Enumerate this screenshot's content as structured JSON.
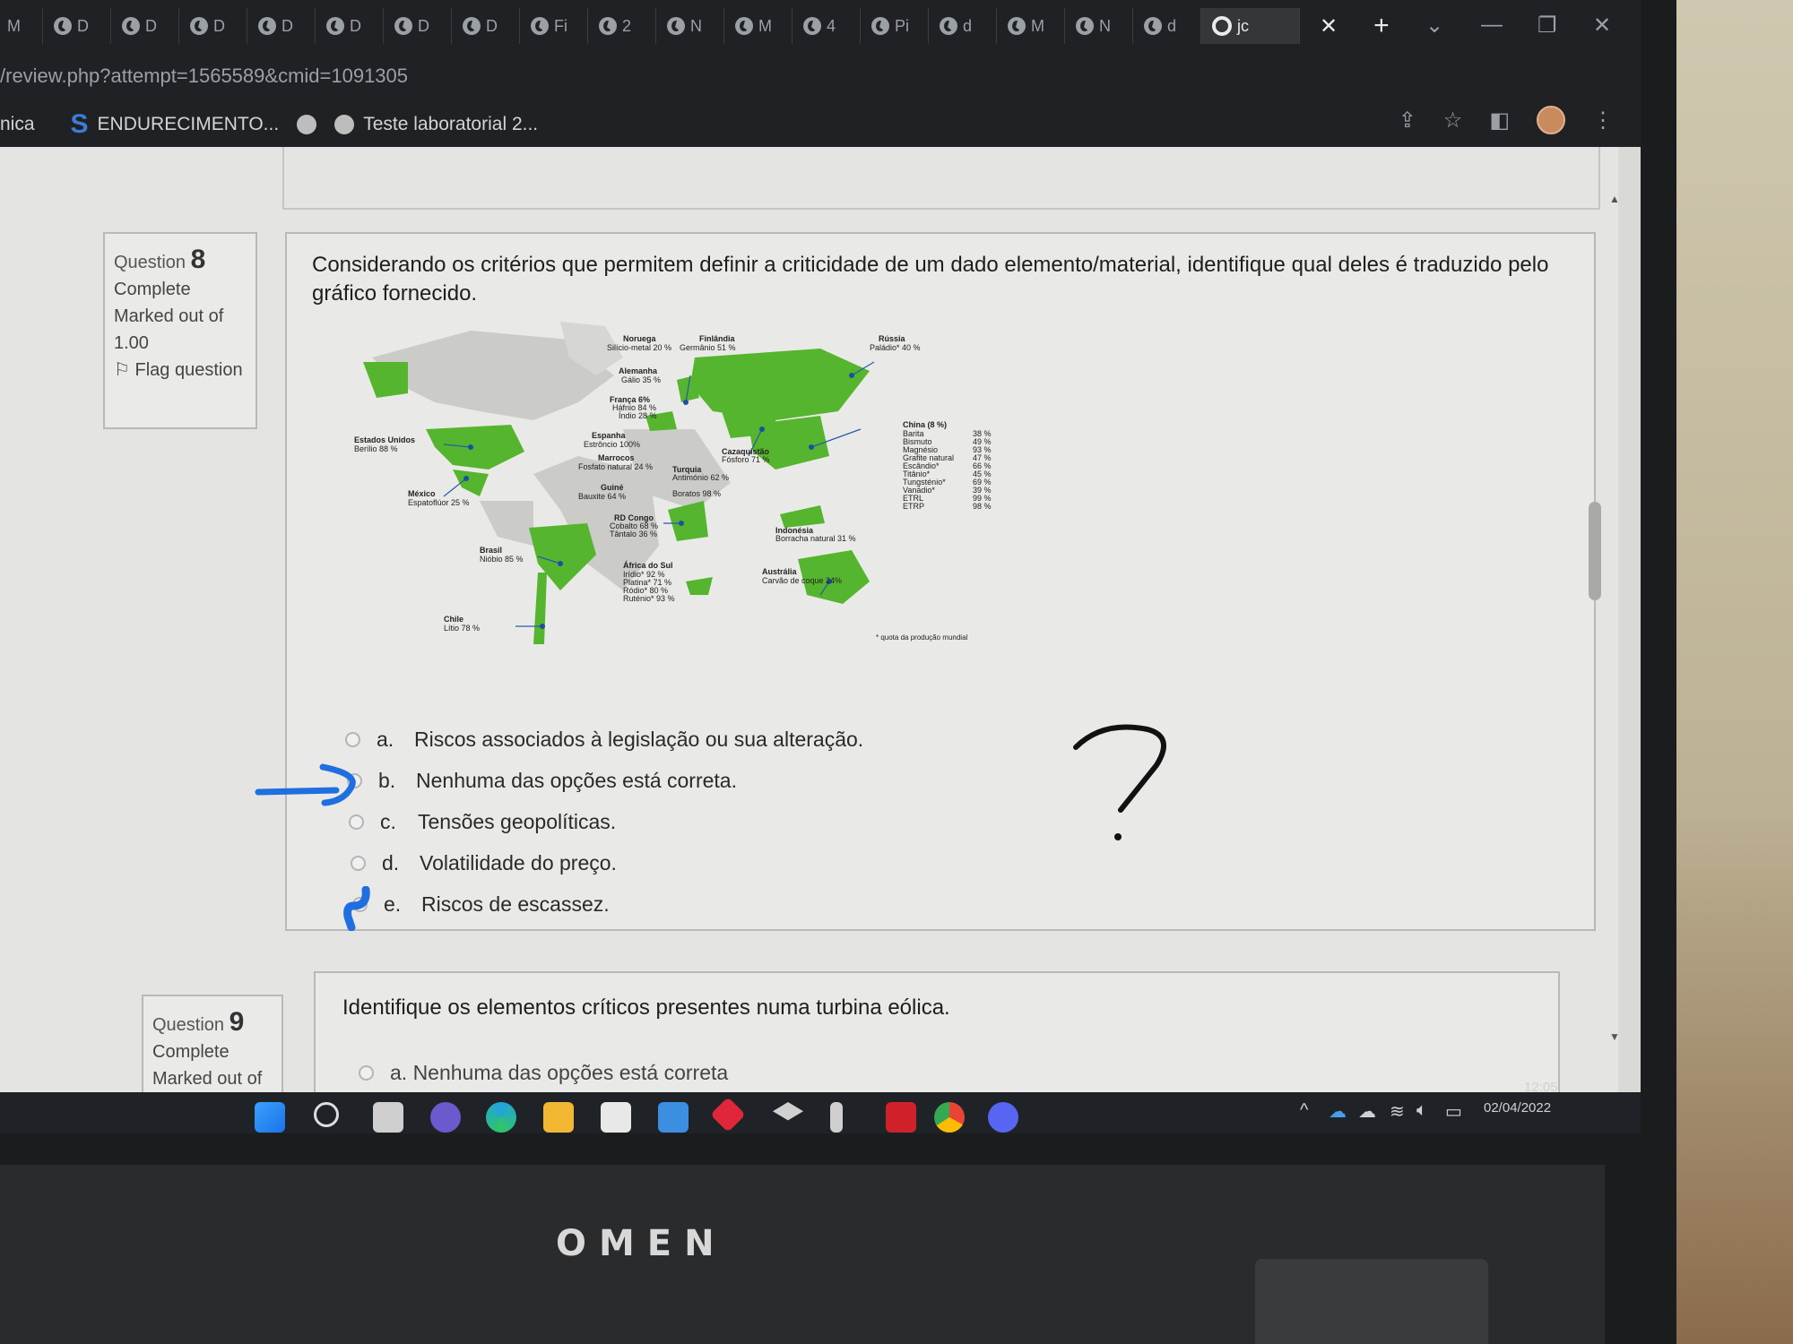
{
  "browser": {
    "tabs": [
      {
        "label": "D"
      },
      {
        "label": "D"
      },
      {
        "label": "D"
      },
      {
        "label": "D"
      },
      {
        "label": "D"
      },
      {
        "label": "D"
      },
      {
        "label": "D"
      },
      {
        "label": "Fi"
      },
      {
        "label": "2"
      },
      {
        "label": "N"
      },
      {
        "label": "M"
      },
      {
        "label": "4"
      },
      {
        "label": "Pi"
      },
      {
        "label": "d"
      },
      {
        "label": "M"
      },
      {
        "label": "N"
      },
      {
        "label": "d"
      }
    ],
    "first_tab_label": "M",
    "active_tab_label": "jc",
    "url": "/review.php?attempt=1565589&cmid=1091305",
    "bookmarks": {
      "partial": "nica",
      "item1": "ENDURECIMENTO...",
      "item2": "Teste laboratorial 2..."
    }
  },
  "question8": {
    "label": "Question",
    "number": "8",
    "status": "Complete",
    "marked": "Marked out of 1.00",
    "flag": "Flag question",
    "prompt": "Considerando os critérios que permitem definir a criticidade de um dado elemento/material, identifique qual deles é traduzido pelo gráfico fornecido.",
    "answers": [
      {
        "letter": "a.",
        "text": "Riscos associados à legislação ou sua alteração."
      },
      {
        "letter": "b.",
        "text": "Nenhuma das opções está correta."
      },
      {
        "letter": "c.",
        "text": "Tensões geopolíticas."
      },
      {
        "letter": "d.",
        "text": "Volatilidade do preço."
      },
      {
        "letter": "e.",
        "text": "Riscos de escassez."
      }
    ]
  },
  "map_labels": {
    "noruega": "Noruega",
    "noruega_v": "Silício-metal 20 %",
    "finlandia": "Finlândia",
    "finlandia_v": "Germânio 51 %",
    "russia": "Rússia",
    "russia_v": "Paládio* 40 %",
    "alemanha": "Alemanha",
    "alemanha_v": "Gálio 35 %",
    "franca": "França 6%",
    "franca_v1": "Háfnio 84 %",
    "franca_v2": "Índio 28 %",
    "eua": "Estados Unidos",
    "eua_v": "Berílio 88 %",
    "espanha": "Espanha",
    "espanha_v": "Estrôncio 100%",
    "marrocos": "Marrocos",
    "marrocos_v": "Fosfato natural 24 %",
    "cazaquistao": "Cazaquistão",
    "cazaquistao_v": "Fósforo 71 %",
    "turquia": "Turquia",
    "turquia_v1": "Antimónio 62 %",
    "turquia_v2": "Boratos 98 %",
    "mexico": "México",
    "mexico_v": "Espatoflúor 25 %",
    "guine": "Guiné",
    "guine_v": "Bauxite 64 %",
    "china": "China (8 %)",
    "china_items": [
      "Barita",
      "Bismuto",
      "Magnésio",
      "Grafite natural",
      "Escândio*",
      "Titânio*",
      "Tungsténio*",
      "Vanádio*",
      "ETRL",
      "ETRP"
    ],
    "china_values": [
      "38 %",
      "49 %",
      "93 %",
      "47 %",
      "66 %",
      "45 %",
      "69 %",
      "39 %",
      "99 %",
      "98 %"
    ],
    "rdcongo": "RD Congo",
    "rdcongo_v1": "Cobalto 68 %",
    "rdcongo_v2": "Tântalo 36 %",
    "indonesia": "Indonésia",
    "indonesia_v": "Borracha natural 31 %",
    "brasil": "Brasil",
    "brasil_v": "Nióbio 85 %",
    "chile": "Chile",
    "chile_v": "Lítio 78 %",
    "africasul": "África do Sul",
    "africasul_v": [
      "Irídio* 92 %",
      "Platina* 71 %",
      "Ródio* 80 %",
      "Ruténio* 93 %"
    ],
    "australia": "Austrália",
    "australia_v": "Carvão de coque 24%",
    "footnote": "* quota da produção mundial"
  },
  "question9": {
    "label": "Question",
    "number": "9",
    "status": "Complete",
    "marked": "Marked out of",
    "prompt": "Identifique os elementos críticos presentes numa turbina eólica.",
    "first_answer": "a.  Nenhuma das opções está correta"
  },
  "handwriting": {
    "mark": "?"
  },
  "taskbar": {
    "time": "12:05",
    "date": "02/04/2022"
  },
  "laptop_brand": "OMEN",
  "colors": {
    "map_green": "#55b52e",
    "map_grey": "#c9c9c6",
    "ink_blue": "#1f6fe0"
  }
}
